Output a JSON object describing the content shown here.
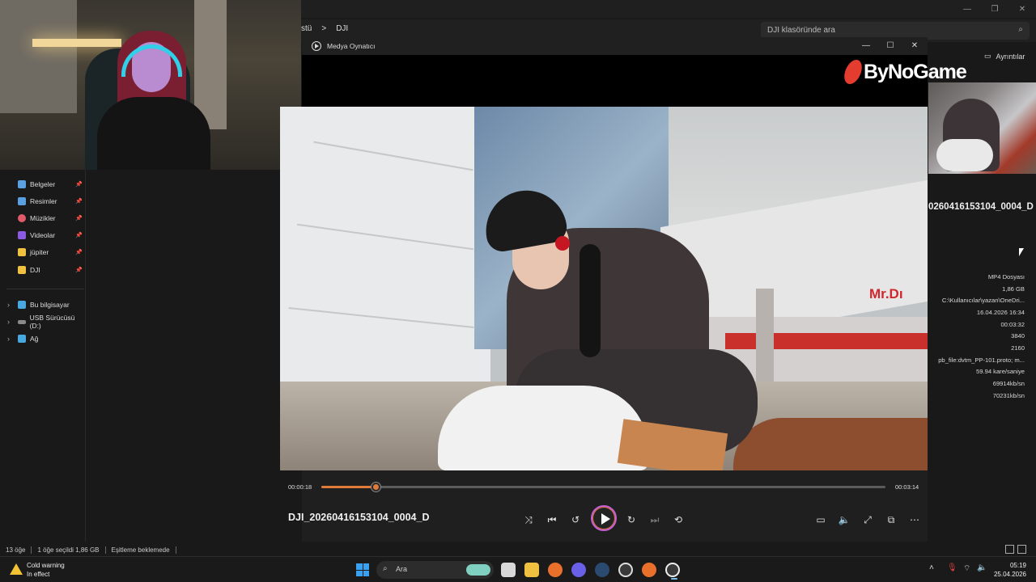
{
  "explorer": {
    "breadcrumb": [
      "stü",
      ">",
      "DJI"
    ],
    "search_placeholder": "DJI klasöründe ara",
    "details_label": "Ayrıntılar",
    "nav": [
      {
        "label": "Belgeler",
        "icon": "documents-icon",
        "color": "#5aa0e0"
      },
      {
        "label": "Resimler",
        "icon": "pictures-icon",
        "color": "#5aa0e0"
      },
      {
        "label": "Müzikler",
        "icon": "music-icon",
        "color": "#e05a6a"
      },
      {
        "label": "Videolar",
        "icon": "videos-icon",
        "color": "#8a5ae0"
      },
      {
        "label": "jüpiter",
        "icon": "folder-icon",
        "color": "#f0c040"
      },
      {
        "label": "DJI",
        "icon": "folder-icon",
        "color": "#f0c040"
      }
    ],
    "tree": [
      {
        "label": "Bu bilgisayar",
        "icon": "pc-icon"
      },
      {
        "label": "USB Sürücüsü (D:)",
        "icon": "drive-icon"
      },
      {
        "label": "Ağ",
        "icon": "network-icon"
      }
    ],
    "file_title": "0260416153104_0004_D",
    "properties": [
      "MP4 Dosyası",
      "1,86 GB",
      "C:\\Kullanıcılar\\yazan\\OneDri...",
      "16.04.2026 16:34",
      "00:03:32",
      "3840",
      "2160",
      "pb_file:dvtm_PP-101.proto; m...",
      "59.94 kare/saniye",
      "69914kb/sn",
      "70231kb/sn"
    ],
    "status": [
      "13 öğe",
      "1 öğe seçildi  1,86 GB",
      "Eşitleme beklemede"
    ]
  },
  "player": {
    "app_name": "Medya Oynatıcı",
    "watermark": "ByNoGame",
    "current_time": "00:00:18",
    "total_time": "00:03:14",
    "progress": 0.096,
    "now_playing": "DJI_20260416153104_0004_D",
    "accent": "#e07a3a",
    "video_sign": "Mr.Dı"
  },
  "taskbar": {
    "warning_title": "Cold warning",
    "warning_sub": "In effect",
    "search_label": "Ara",
    "time": "05:19",
    "date": "25.04.2026"
  }
}
